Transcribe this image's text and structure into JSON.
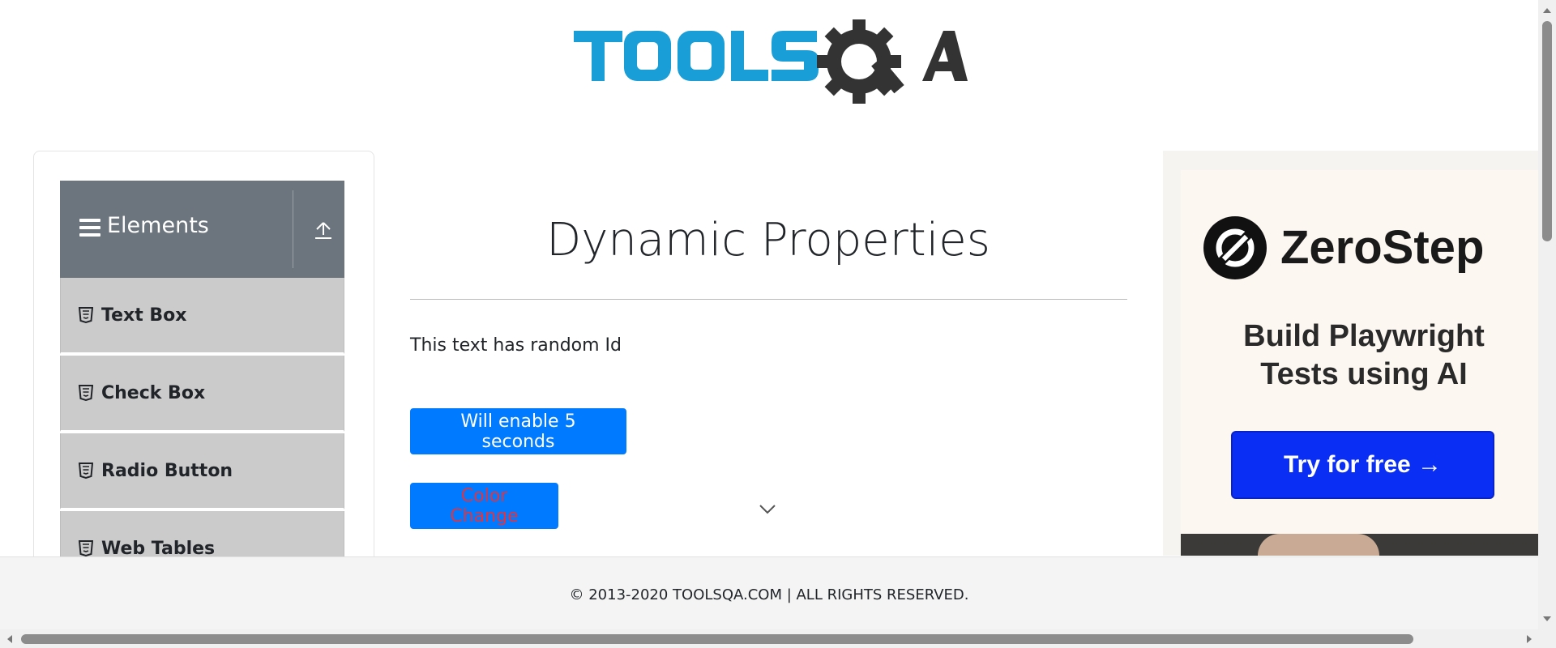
{
  "header": {
    "logo_text": "TOOLSQA"
  },
  "sidebar": {
    "group_title": "Elements",
    "items": [
      {
        "label": "Text Box"
      },
      {
        "label": "Check Box"
      },
      {
        "label": "Radio Button"
      },
      {
        "label": "Web Tables"
      }
    ]
  },
  "main": {
    "title": "Dynamic Properties",
    "random_text": "This text has random Id",
    "enable_button_label": "Will enable 5 seconds",
    "color_button_label": "Color Change"
  },
  "ad": {
    "brand": "ZeroStep",
    "tagline_line1": "Build Playwright",
    "tagline_line2": "Tests using AI",
    "cta_label": "Try for free →"
  },
  "footer": {
    "text": "© 2013-2020 TOOLSQA.COM | ALL RIGHTS RESERVED."
  },
  "colors": {
    "primary": "#007bff",
    "danger": "#dc3545",
    "group_header": "#6c757d",
    "menu_item": "#cbcbcb",
    "logo_blue": "#1a9ed8",
    "logo_dark": "#333333",
    "ad_cta": "#0b2ef5"
  }
}
